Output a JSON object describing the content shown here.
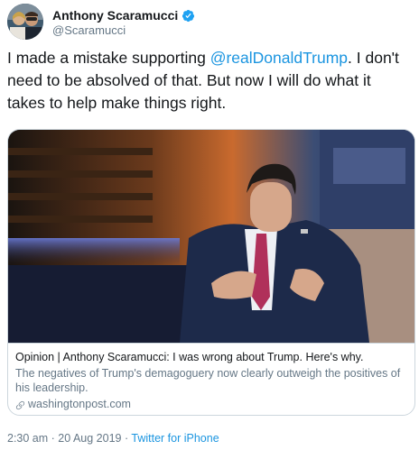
{
  "author": {
    "name": "Anthony Scaramucci",
    "handle": "@Scaramucci",
    "verified": true,
    "verified_icon": "verified-badge-icon"
  },
  "tweet": {
    "text_before": "I made a mistake supporting ",
    "mention": "@realDonaldTrump",
    "text_after": ". I don't need to be absolved of that. But now I will do what it takes to help make things right."
  },
  "card": {
    "title": "Opinion | Anthony Scaramucci: I was wrong about Trump. Here's why.",
    "description": "The negatives of Trump's demagoguery now clearly outweigh the positives of his leadership.",
    "domain": "washingtonpost.com",
    "domain_icon": "link-icon"
  },
  "meta": {
    "time": "2:30 am",
    "separator1": " · ",
    "date": "20 Aug 2019",
    "separator2": " · ",
    "source": "Twitter for iPhone"
  },
  "colors": {
    "link": "#1b95e0",
    "text": "#14171a",
    "muted": "#657786",
    "border": "#ccd6dd"
  }
}
